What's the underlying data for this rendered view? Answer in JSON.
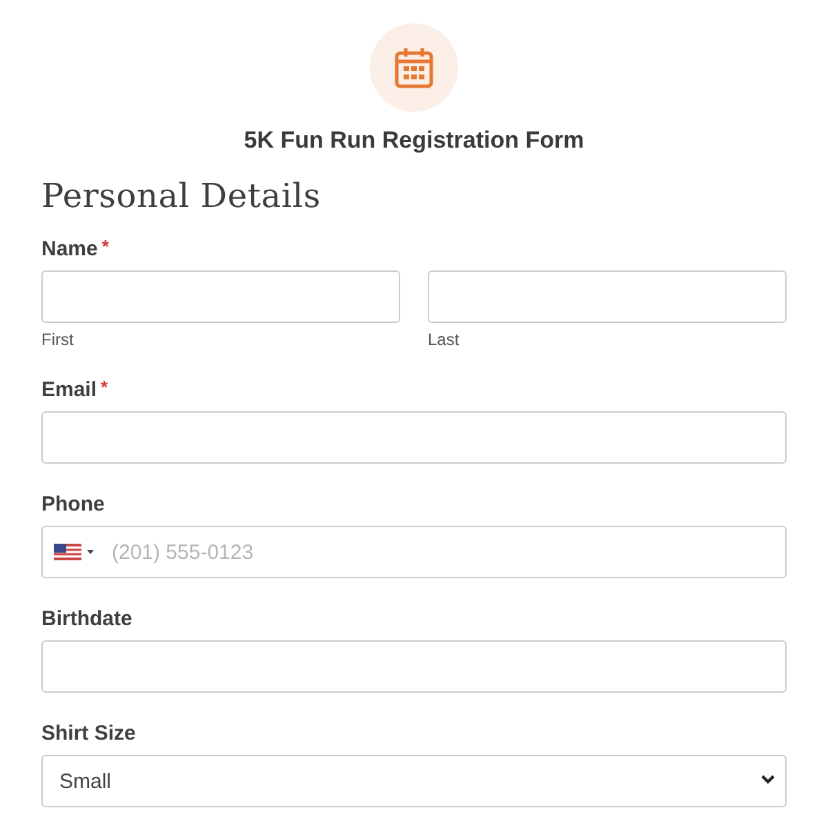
{
  "form_title": "5K Fun Run Registration Form",
  "section_heading": "Personal Details",
  "fields": [
    {
      "kind": "name",
      "label": "Name",
      "required_mark": "*",
      "parts": [
        {
          "sublabel": "First"
        },
        {
          "sublabel": "Last"
        }
      ]
    },
    {
      "kind": "text",
      "label": "Email",
      "required_mark": "*"
    },
    {
      "kind": "phone",
      "label": "Phone",
      "placeholder": "(201) 555-0123"
    },
    {
      "kind": "text",
      "label": "Birthdate"
    },
    {
      "kind": "select",
      "label": "Shirt Size",
      "value": "Small"
    }
  ]
}
